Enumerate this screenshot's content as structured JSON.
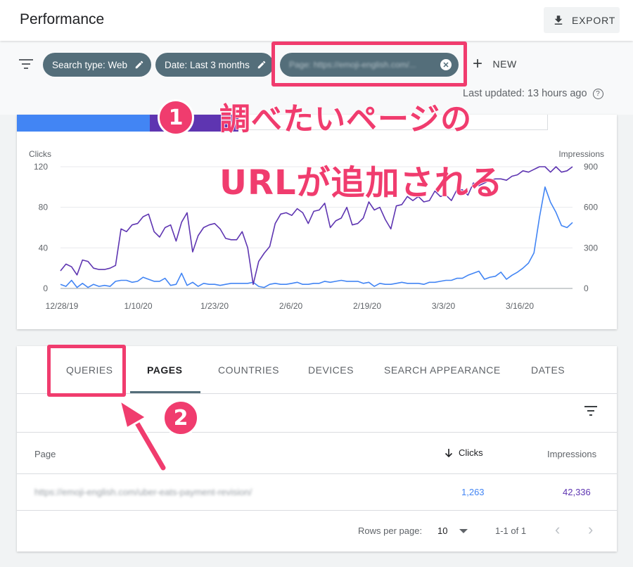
{
  "header": {
    "title": "Performance",
    "export_label": "EXPORT"
  },
  "filters": {
    "chips": [
      {
        "label": "Search type: Web"
      },
      {
        "label": "Date: Last 3 months"
      },
      {
        "label": "Page: https://emoji-english.com/..."
      }
    ],
    "new_label": "NEW",
    "last_updated": "Last updated: 13 hours ago"
  },
  "annotations": {
    "step1_number": "1",
    "step1_line1": "調べたいページの",
    "step1_line2": "URLが追加される",
    "step2_number": "2"
  },
  "colors": {
    "clicks": "#4285f4",
    "impressions": "#5e35b1",
    "highlight": "#f03c6e",
    "chip": "#546e7a"
  },
  "chart_data": {
    "type": "line",
    "ylabel_left": "Clicks",
    "ylabel_right": "Impressions",
    "left_ticks": [
      "120",
      "80",
      "40",
      "0"
    ],
    "right_ticks": [
      "900",
      "600",
      "300",
      "0"
    ],
    "ylim_left": [
      0,
      120
    ],
    "ylim_right": [
      0,
      900
    ],
    "x_ticks": [
      "12/28/19",
      "1/10/20",
      "1/23/20",
      "2/6/20",
      "2/19/20",
      "3/3/20",
      "3/16/20"
    ],
    "grid": true,
    "series": [
      {
        "name": "Clicks",
        "axis": "left",
        "values": [
          4,
          2,
          8,
          1,
          5,
          1,
          4,
          2,
          3,
          2,
          7,
          8,
          8,
          6,
          7,
          11,
          9,
          7,
          7,
          10,
          3,
          4,
          15,
          3,
          6,
          2,
          5,
          4,
          4,
          3,
          4,
          5,
          5,
          5,
          5,
          6,
          2,
          1,
          4,
          5,
          4,
          4,
          5,
          6,
          4,
          4,
          5,
          5,
          7,
          6,
          7,
          8,
          7,
          7,
          7,
          5,
          6,
          2,
          5,
          4,
          4,
          5,
          6,
          5,
          5,
          5,
          4,
          6,
          6,
          7,
          8,
          8,
          10,
          10,
          13,
          15,
          17,
          9,
          11,
          12,
          16,
          9,
          13,
          16,
          20,
          25,
          35,
          70,
          100,
          85,
          75,
          62,
          60,
          65
        ]
      },
      {
        "name": "Impressions",
        "axis": "right",
        "values": [
          130,
          180,
          160,
          100,
          210,
          200,
          150,
          140,
          140,
          150,
          170,
          440,
          420,
          470,
          480,
          530,
          550,
          420,
          380,
          450,
          470,
          350,
          490,
          560,
          270,
          390,
          450,
          470,
          480,
          440,
          370,
          360,
          360,
          420,
          300,
          30,
          200,
          260,
          310,
          480,
          550,
          560,
          540,
          590,
          560,
          480,
          570,
          580,
          630,
          450,
          500,
          520,
          600,
          470,
          480,
          520,
          640,
          580,
          600,
          510,
          440,
          610,
          620,
          680,
          650,
          680,
          640,
          650,
          720,
          680,
          690,
          650,
          730,
          730,
          690,
          780,
          760,
          780,
          800,
          810,
          810,
          800,
          830,
          840,
          870,
          860,
          880,
          900,
          900,
          860,
          900,
          860,
          870,
          900
        ]
      }
    ]
  },
  "tabs": [
    {
      "label": "QUERIES"
    },
    {
      "label": "PAGES"
    },
    {
      "label": "COUNTRIES"
    },
    {
      "label": "DEVICES"
    },
    {
      "label": "SEARCH APPEARANCE"
    },
    {
      "label": "DATES"
    }
  ],
  "table": {
    "columns": {
      "page": "Page",
      "clicks": "Clicks",
      "impressions": "Impressions"
    },
    "rows": [
      {
        "page": "https://emoji-english.com/uber-eats-payment-revision/",
        "clicks": "1,263",
        "impressions": "42,336"
      }
    ],
    "footer": {
      "rows_per_page_label": "Rows per page:",
      "rows_per_page_value": "10",
      "range": "1-1 of 1"
    }
  }
}
